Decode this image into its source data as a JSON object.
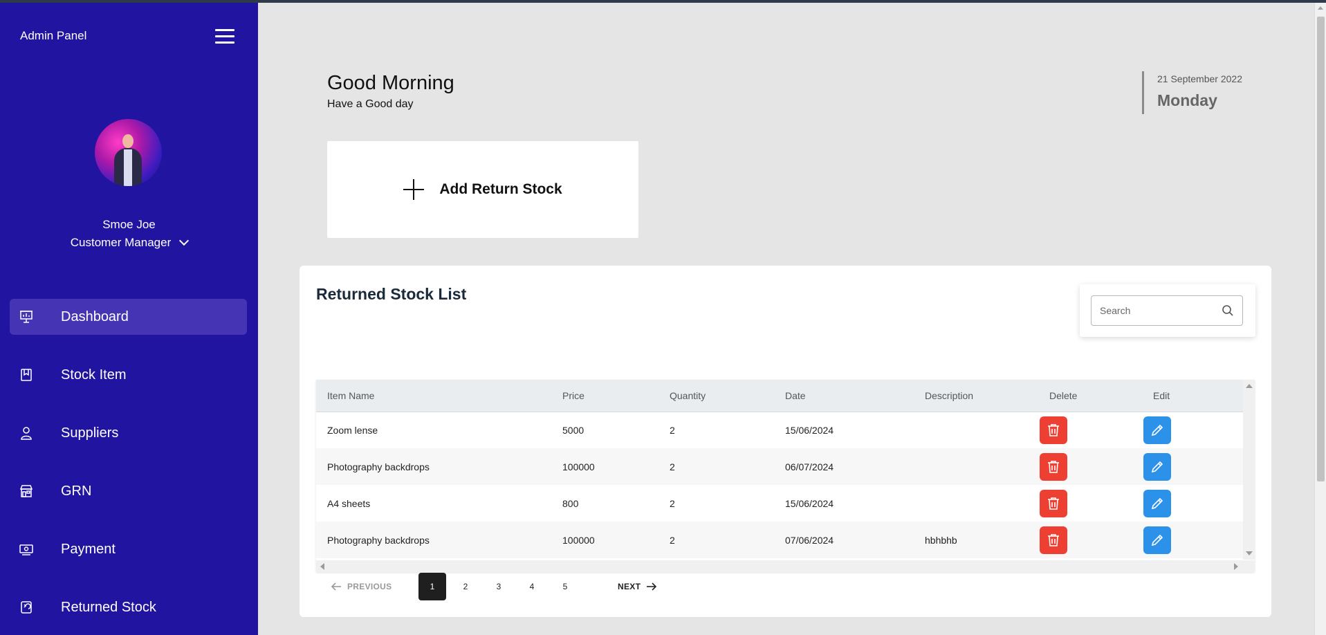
{
  "sidebar": {
    "title": "Admin Panel",
    "user": {
      "name": "Smoe Joe",
      "role": "Customer Manager"
    },
    "items": [
      {
        "label": "Dashboard",
        "icon": "presentation-chart-icon",
        "active": true
      },
      {
        "label": "Stock Item",
        "icon": "bookmark-book-icon",
        "active": false
      },
      {
        "label": "Suppliers",
        "icon": "user-icon",
        "active": false
      },
      {
        "label": "GRN",
        "icon": "store-icon",
        "active": false
      },
      {
        "label": "Payment",
        "icon": "money-icon",
        "active": false
      },
      {
        "label": "Returned Stock",
        "icon": "return-receipt-icon",
        "active": false
      }
    ]
  },
  "header": {
    "greeting": "Good Morning",
    "subtitle": "Have a Good day",
    "date": "21 September 2022",
    "day": "Monday"
  },
  "add_card": {
    "label": "Add Return Stock"
  },
  "list": {
    "title": "Returned Stock List",
    "search_placeholder": "Search",
    "columns": [
      "Item Name",
      "Price",
      "Quantity",
      "Date",
      "Description",
      "Delete",
      "Edit"
    ],
    "rows": [
      {
        "item": "Zoom lense",
        "price": "5000",
        "quantity": "2",
        "date": "15/06/2024",
        "description": ""
      },
      {
        "item": "Photography backdrops",
        "price": "100000",
        "quantity": "2",
        "date": "06/07/2024",
        "description": ""
      },
      {
        "item": "A4 sheets",
        "price": "800",
        "quantity": "2",
        "date": "15/06/2024",
        "description": ""
      },
      {
        "item": "Photography backdrops",
        "price": "100000",
        "quantity": "2",
        "date": "07/06/2024",
        "description": "hbhbhb"
      }
    ]
  },
  "pagination": {
    "prev_label": "PREVIOUS",
    "next_label": "NEXT",
    "pages": [
      "1",
      "2",
      "3",
      "4",
      "5"
    ],
    "current": "1"
  },
  "colors": {
    "sidebar_bg": "#2114a0",
    "active_item": "#4535b4",
    "delete_button": "#ee3f33",
    "edit_button": "#2c92e9"
  }
}
